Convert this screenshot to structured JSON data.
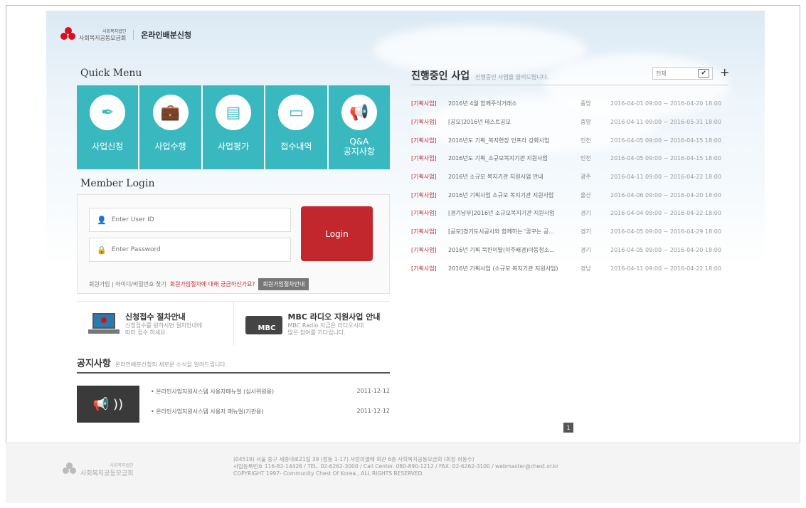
{
  "header": {
    "org_small": "사회복지법인",
    "org": "사회복지공동모금회",
    "title": "온라인배분신청"
  },
  "quick_menu": {
    "title": "Quick Menu",
    "items": [
      {
        "label": "사업신청",
        "icon": "pen-nib-icon"
      },
      {
        "label": "사업수행",
        "icon": "briefcase-icon"
      },
      {
        "label": "사업평가",
        "icon": "document-icon"
      },
      {
        "label": "접수내역",
        "icon": "monitor-icon"
      },
      {
        "label": "Q&A\n공지사항",
        "icon": "megaphone-icon"
      }
    ]
  },
  "login": {
    "title": "Member Login",
    "id_placeholder": "Enter User ID",
    "pw_placeholder": "Enter Password",
    "button": "Login",
    "links_text": "회원가입 | 아이디/비밀번호 찾기",
    "question": "회원가입절차에 대해 궁금하신가요?",
    "guide_button": "회원가입절차안내"
  },
  "banners": [
    {
      "title": "신청접수 절차안내",
      "desc1": "신청접수를 원하시면 절차안내에",
      "desc2": "따라 접수 하세요."
    },
    {
      "title": "MBC 라디오 지원사업 안내",
      "desc1": "MBC Radio 지금은 라디오시대",
      "desc2": "많은 참여를 기다립니다."
    }
  ],
  "notice": {
    "title": "공지사항",
    "subtitle": "온라인배분신청의 새로운 소식을 알려드립니다.",
    "items": [
      {
        "title": "• 온라인사업지원시스템 사용자매뉴얼 (심사위원용)",
        "date": "2011-12-12"
      },
      {
        "title": "• 온라인사업지원시스템 사용자 매뉴얼(기관용)",
        "date": "2011-12-12"
      }
    ]
  },
  "business": {
    "title": "진행중인 사업",
    "subtitle": "진행중인 사업을 알려드립니다.",
    "filter": "전체",
    "plus": "+",
    "rows": [
      {
        "tag": "[기획사업]",
        "name": "2016년 4월 함께주식거래소",
        "region": "중앙",
        "date": "2016-04-01 09:00 ~ 2016-04-20 18:00"
      },
      {
        "tag": "[기획사업]",
        "name": "[공모]2016년 테스트공모",
        "region": "중앙",
        "date": "2016-04-11 09:00 ~ 2016-05-31 18:00"
      },
      {
        "tag": "[기획사업]",
        "name": "2016년도 기획_복지현장 인프라 강화사업",
        "region": "인천",
        "date": "2016-04-05 09:00 ~ 2016-04-15 18:00"
      },
      {
        "tag": "[기획사업]",
        "name": "2016년도 기획_소규모복지기관 지원사업",
        "region": "인천",
        "date": "2016-04-05 09:00 ~ 2016-04-15 18:00"
      },
      {
        "tag": "[기획사업]",
        "name": "2016년 소규모 복지기관 지원사업 안내",
        "region": "광주",
        "date": "2016-04-11 09:00 ~ 2016-04-22 18:00"
      },
      {
        "tag": "[기획사업]",
        "name": "2016년 기획사업 소규모 복지기관 지원사업",
        "region": "울산",
        "date": "2016-04-06 09:00 ~ 2016-04-20 18:00"
      },
      {
        "tag": "[기획사업]",
        "name": "[경기남부]2016년 소규모복지기관 지원사업",
        "region": "경기",
        "date": "2016-04-04 09:00 ~ 2016-04-22 18:00"
      },
      {
        "tag": "[기획사업]",
        "name": "[공모]경기도시공사와 함께하는 '꿈꾸는 공...",
        "region": "경기",
        "date": "2016-04-05 09:00 ~ 2016-04-29 18:00"
      },
      {
        "tag": "[기획사업]",
        "name": "2016년 기획 북한이탈(이주배경)아동청소...",
        "region": "경기",
        "date": "2016-04-05 09:00 ~ 2016-04-20 18:00"
      },
      {
        "tag": "[기획사업]",
        "name": "2016년 기획사업 (소규모 복지기관 지원사업)",
        "region": "경남",
        "date": "2016-04-11 09:00 ~ 2016-04-22 18:00"
      }
    ]
  },
  "pager": {
    "current": "1"
  },
  "footer": {
    "org_small": "사회복지법인",
    "org": "사회복지공동모금회",
    "line1": "(04519) 서울 중구 세종대로21길 39 (정동 1-17) 사랑의열매 회관 6층 사회복지공동모금회 (회장 허동수)",
    "line2": "사업등록번호 116-82-14426 / TEL. 02-6262-3000 / Call Center. 080-890-1212 / FAX. 02-6262-3100 / webmaster@chest.or.kr",
    "line3": "COPYRIGHT 1997- Community Chest Of Korea., ALL RIGHTS RESERVED."
  },
  "colors": {
    "teal": "#3ab8c0",
    "red": "#c1272d"
  }
}
